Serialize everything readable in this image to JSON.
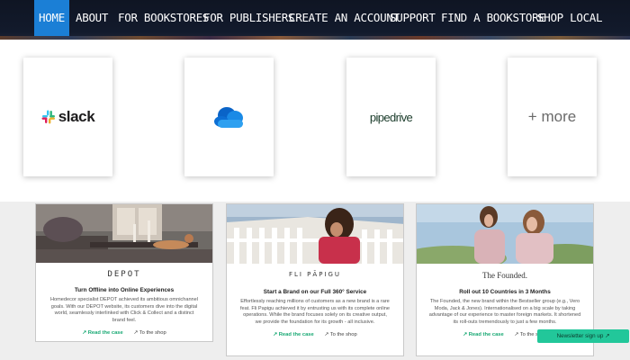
{
  "nav": {
    "items": [
      {
        "label": "HOME",
        "active": true
      },
      {
        "label": "ABOUT"
      },
      {
        "label": "FOR BOOKSTORES"
      },
      {
        "label": "FOR PUBLISHERS"
      },
      {
        "label": "CREATE AN ACCOUNT"
      },
      {
        "label": "SUPPORT"
      },
      {
        "label": "FIND A BOOKSTORE"
      },
      {
        "label": "SHOP LOCAL"
      }
    ]
  },
  "integrations": {
    "slack": "slack",
    "pipedrive": "pipedrive",
    "more": "+ more",
    "cloud_icon": "onedrive-cloud-icon"
  },
  "cases": [
    {
      "brand": "DEPOT",
      "headline": "Turn Offline into Online Experiences",
      "desc": "Homedecor specialist DEPOT achieved its ambitious omnichannel goals. With our DEPOT website, its customers dive into the digital world, seamlessly interlinked with Click & Collect and a distinct brand feel.",
      "read": "↗ Read the case",
      "shop": "↗ To the shop"
    },
    {
      "brand": "FLI PĀPIGU",
      "headline": "Start a Brand on our Full 360° Service",
      "desc": "Effortlessly reaching millions of customers as a new brand is a rare feat. Fli Papigu achieved it by entrusting us with its complete online operations. While the brand focuses solely on its creative output, we provide the foundation for its growth - all inclusive.",
      "read": "↗ Read the case",
      "shop": "↗ To the shop"
    },
    {
      "brand": "The Founded.",
      "headline": "Roll out 10 Countries in 3 Months",
      "desc": "The Founded, the new brand within the Bestseller group (e.g., Vero Moda, Jack & Jones). Internationalised on a big scale by taking advantage of our experience to master foreign markets. It shortened its roll-outs tremendously to just a few months.",
      "read": "↗ Read the case",
      "shop": "↗ To the shop"
    }
  ],
  "newsletter": "Newsletter sign up ↗",
  "colors": {
    "nav_bg": "#121a2c",
    "nav_active": "#1b7fd6",
    "accent_green": "#19a974",
    "newsletter_bg": "#22c79a"
  }
}
